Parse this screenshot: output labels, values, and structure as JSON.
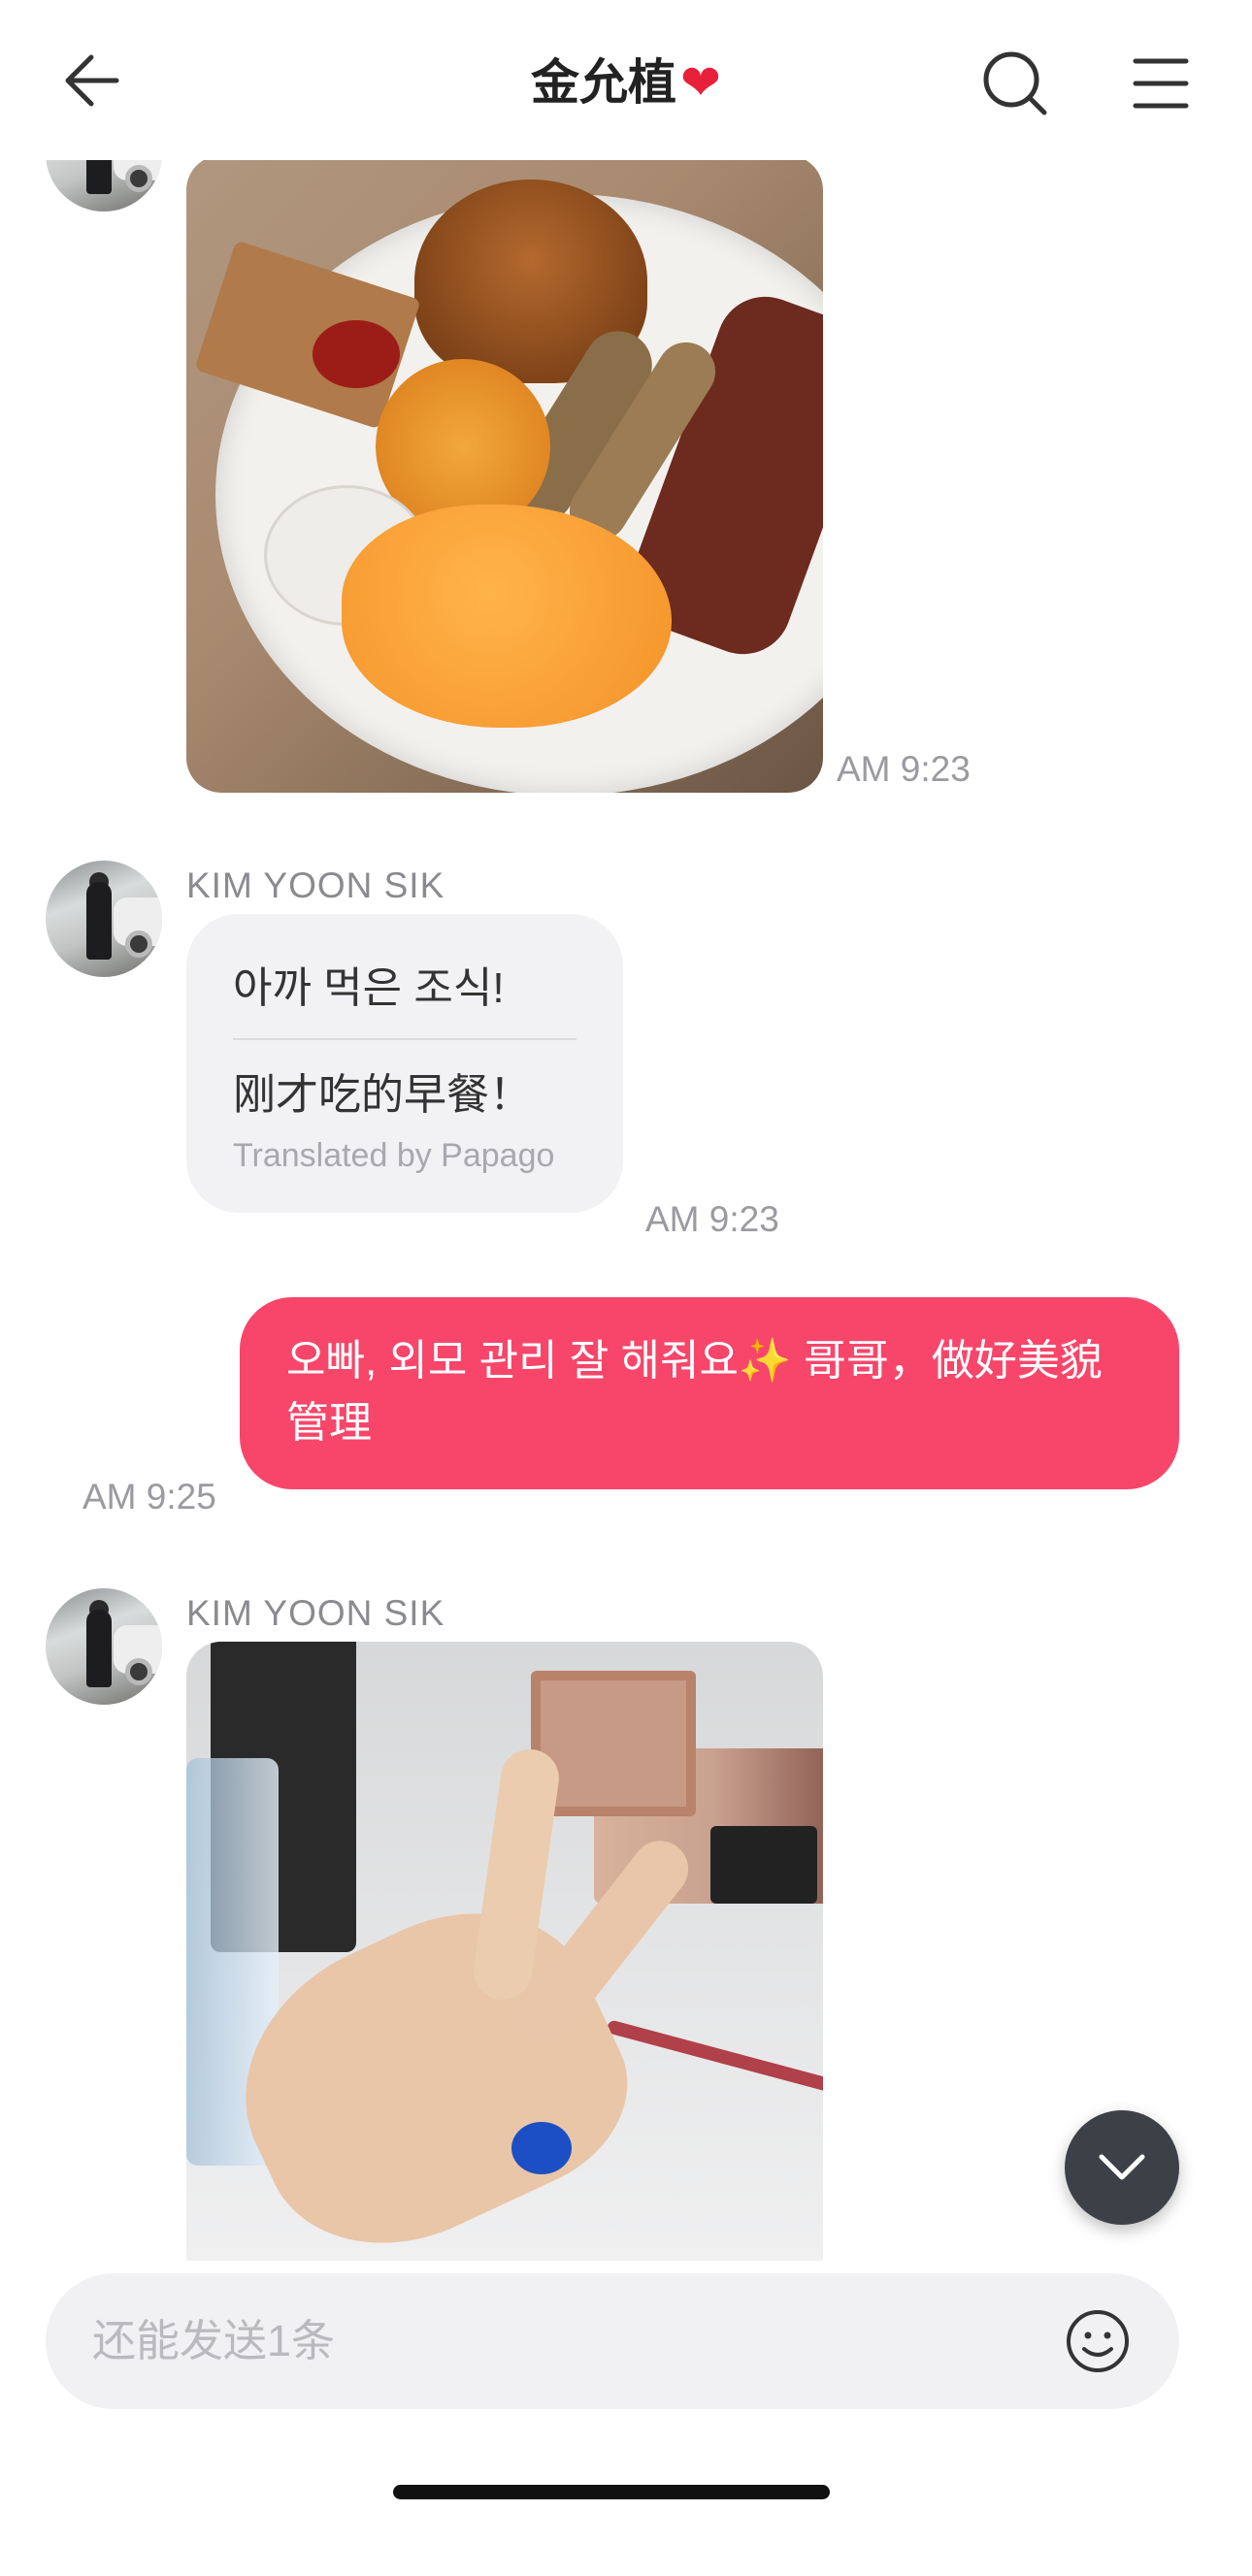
{
  "header": {
    "back_icon": "arrow-left-icon",
    "title": "金允植",
    "title_heart": "❤",
    "search_icon": "search-icon",
    "menu_icon": "hamburger-menu-icon"
  },
  "messages": [
    {
      "type": "image",
      "direction": "received",
      "image_description_icon": "breakfast-photo",
      "time": "AM 9:23"
    },
    {
      "type": "text",
      "direction": "received",
      "sender": "KIM YOON SIK",
      "original_text": "아까 먹은 조식!",
      "translated_text": "刚才吃的早餐！",
      "translation_credit": "Translated by Papago",
      "time": "AM 9:23"
    },
    {
      "type": "text",
      "direction": "sent",
      "text": "오빠, 외모 관리 잘 해줘요✨ 哥哥，做好美貌管理",
      "time": "AM 9:25"
    },
    {
      "type": "image",
      "direction": "received",
      "sender": "KIM YOON SIK",
      "image_description_icon": "makeup-table-photo"
    }
  ],
  "input": {
    "placeholder": "还能发送1条",
    "emoji_icon": "smiley-icon"
  },
  "scroll_button_icon": "chevron-down-icon",
  "colors": {
    "sent_bubble": "#f7466a",
    "received_bubble": "#f2f2f4",
    "scroll_button": "#3d4047",
    "heart": "#e8203a"
  }
}
